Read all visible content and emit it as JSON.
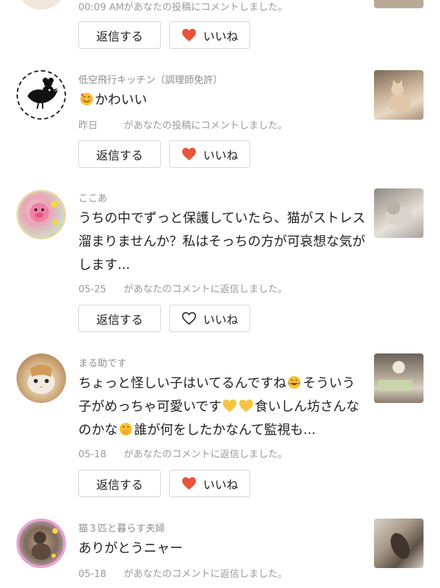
{
  "colors": {
    "heart_red": "#e8553b",
    "meta_gray": "#9a9a9a",
    "border": "#d4d4d4"
  },
  "buttons": {
    "reply_label": "返信する",
    "like_label": "いいね"
  },
  "notifications": [
    {
      "time": "00:09 AM",
      "action": "があなたの投稿にコメントしました。",
      "liked": true
    },
    {
      "username": "低空飛行キッチン（調理師免許）",
      "text": "かわいい",
      "emoji_prefix": "smiling-face-with-hearts-icon",
      "time": "昨日",
      "action": "があなたの投稿にコメントしました。",
      "liked": true
    },
    {
      "username": "ここあ",
      "text": "うちの中でずっと保護していたら、猫がストレス溜まりませんか？私はそっちの方が可哀想な気がします...",
      "time": "05-25",
      "action": "があなたのコメントに返信しました。",
      "liked": false
    },
    {
      "username": "まる助です",
      "text_parts": [
        "ちょっと怪しい子はいてるんですね",
        "そういう子がめっちゃ可愛いです",
        "食いしん坊さんなのかな",
        "誰が何をしたかなんて監視も..."
      ],
      "time": "05-18",
      "action": "があなたのコメントに返信しました。",
      "liked": true
    },
    {
      "username": "猫３匹と暮らす夫婦",
      "text": "ありがとうニャー",
      "time": "05-18",
      "action": "があなたのコメントに返信しました。"
    }
  ]
}
